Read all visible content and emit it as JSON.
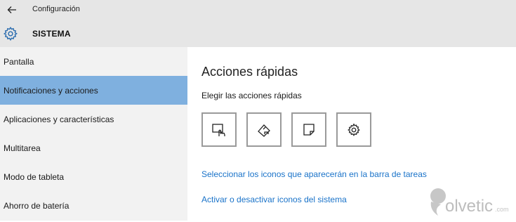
{
  "header": {
    "app_title": "Configuración",
    "section_title": "SISTEMA",
    "back_icon": "back-arrow-icon",
    "section_icon": "gear-icon"
  },
  "sidebar": {
    "items": [
      {
        "label": "Pantalla",
        "active": false
      },
      {
        "label": "Notificaciones y acciones",
        "active": true
      },
      {
        "label": "Aplicaciones y características",
        "active": false
      },
      {
        "label": "Multitarea",
        "active": false
      },
      {
        "label": "Modo de tableta",
        "active": false
      },
      {
        "label": "Ahorro de batería",
        "active": false
      }
    ]
  },
  "main": {
    "title": "Acciones rápidas",
    "subtitle": "Elegir las acciones rápidas",
    "quick_actions": [
      {
        "icon": "tablet-mode-icon"
      },
      {
        "icon": "connect-icon"
      },
      {
        "icon": "note-icon"
      },
      {
        "icon": "settings-gear-icon"
      }
    ],
    "links": [
      "Seleccionar los iconos que aparecerán en la barra de tareas",
      "Activar o desactivar iconos del sistema"
    ]
  },
  "watermark": {
    "text": "olvetic",
    "suffix": ".com"
  },
  "colors": {
    "header_bg": "#e6e6e6",
    "sidebar_bg": "#f2f2f2",
    "active_bg": "#7fb0df",
    "link": "#1a73c9",
    "tile_border": "#9a9a9a"
  }
}
